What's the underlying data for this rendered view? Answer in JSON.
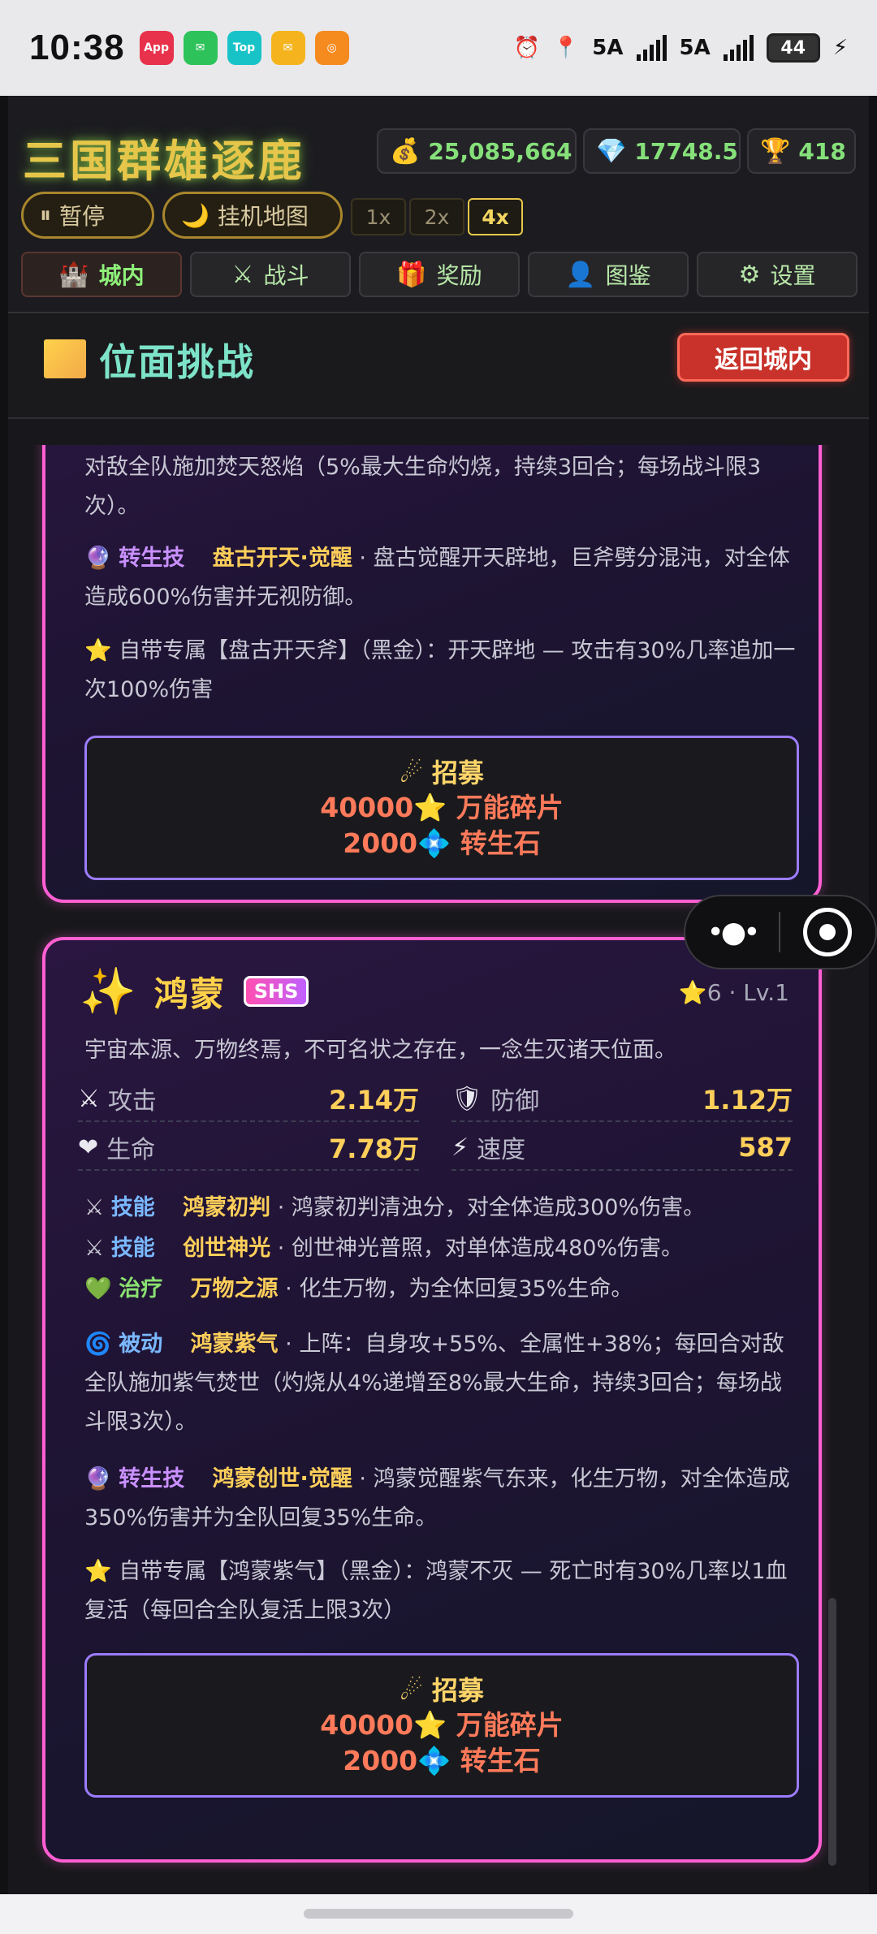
{
  "status": {
    "time": "10:38",
    "apps": [
      {
        "name": "AppGallery",
        "label": "App",
        "color": "#e8314a"
      },
      {
        "name": "WeChat",
        "label": "✉",
        "color": "#2dc35a"
      },
      {
        "name": "TapTap",
        "label": "Top",
        "color": "#18c3c8"
      },
      {
        "name": "Mail",
        "label": "✉",
        "color": "#f5b41e"
      },
      {
        "name": "Other",
        "label": "◎",
        "color": "#f58a1e"
      }
    ],
    "net1": "5A",
    "net2": "5A",
    "battery": "44"
  },
  "header": {
    "title": "三国群雄逐鹿",
    "gold": "25,085,664",
    "diamond": "17748.5",
    "trophy": "418",
    "pause_label": "暂停",
    "idle_map_label": "挂机地图",
    "speeds": [
      "1x",
      "2x",
      "4x"
    ],
    "active_speed": "4x"
  },
  "nav": {
    "tabs": [
      {
        "label": "城内",
        "icon": "castle-icon"
      },
      {
        "label": "战斗",
        "icon": "swords-icon"
      },
      {
        "label": "奖励",
        "icon": "gift-icon"
      },
      {
        "label": "图鉴",
        "icon": "person-icon"
      },
      {
        "label": "设置",
        "icon": "gear-icon"
      }
    ],
    "active": "城内"
  },
  "section": {
    "title": "位面挑战",
    "back_label": "返回城内"
  },
  "card1": {
    "passive_tail": "对敌全队施加焚天怒焰（5%最大生命灼烧，持续3回合；每场战斗限3次）。",
    "rebirth_tag": "转生技",
    "rebirth_name": "盘古开天·觉醒",
    "rebirth_desc": "· 盘古觉醒开天辟地，巨斧劈分混沌，对全体造成600%伤害并无视防御。",
    "exclusive": "自带专属【盘古开天斧】（黑金）：开天辟地 — 攻击有30%几率追加一次100%伤害",
    "recruit_label": "招募",
    "cost_fragments": "40000",
    "fragments_label": "万能碎片",
    "cost_stones": "2000",
    "stones_label": "转生石"
  },
  "card2": {
    "name": "鸿蒙",
    "rarity": "SHS",
    "stars": "6",
    "level": "Lv.1",
    "desc": "宇宙本源、万物终焉，不可名状之存在，一念生灭诸天位面。",
    "stats": {
      "atk_label": "攻击",
      "atk": "2.14万",
      "def_label": "防御",
      "def": "1.12万",
      "hp_label": "生命",
      "hp": "7.78万",
      "spd_label": "速度",
      "spd": "587"
    },
    "skills": [
      {
        "tag": "技能",
        "name": "鸿蒙初判",
        "desc": "· 鸿蒙初判清浊分，对全体造成300%伤害。"
      },
      {
        "tag": "技能",
        "name": "创世神光",
        "desc": "· 创世神光普照，对单体造成480%伤害。"
      },
      {
        "tag": "治疗",
        "name": "万物之源",
        "desc": "· 化生万物，为全体回复35%生命。"
      }
    ],
    "passive_tag": "被动",
    "passive_name": "鸿蒙紫气",
    "passive_desc": "· 上阵：自身攻+55%、全属性+38%；每回合对敌全队施加紫气焚世（灼烧从4%递增至8%最大生命，持续3回合；每场战斗限3次）。",
    "rebirth_tag": "转生技",
    "rebirth_name": "鸿蒙创世·觉醒",
    "rebirth_desc": "· 鸿蒙觉醒紫气东来，化生万物，对全体造成350%伤害并为全队回复35%生命。",
    "exclusive": "自带专属【鸿蒙紫气】（黑金）：鸿蒙不灭 — 死亡时有30%几率以1血复活（每回合全队复活上限3次）",
    "recruit_label": "招募",
    "cost_fragments": "40000",
    "fragments_label": "万能碎片",
    "cost_stones": "2000",
    "stones_label": "转生石"
  }
}
